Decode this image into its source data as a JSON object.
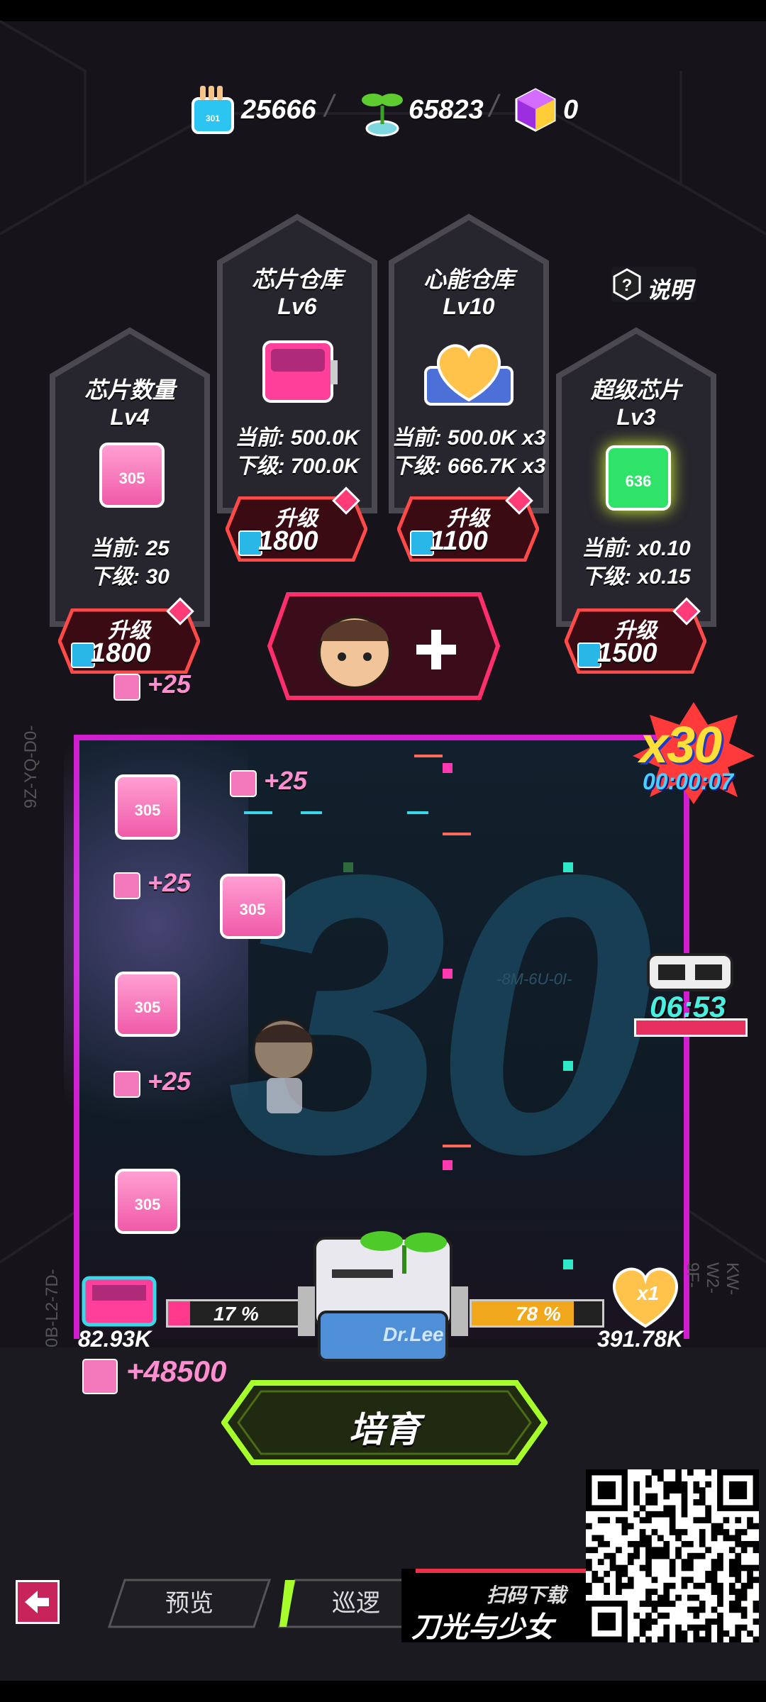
{
  "resources": [
    {
      "icon": "chip-blue-icon",
      "value": "25666"
    },
    {
      "icon": "sprout-icon",
      "value": "65823"
    },
    {
      "icon": "purple-cube-icon",
      "value": "0"
    }
  ],
  "help": {
    "label": "说明"
  },
  "towers": [
    {
      "title": "芯片数量",
      "level": "Lv4",
      "current": "当前: 25",
      "next": "下级: 30",
      "upgrade_label": "升级",
      "cost": "1800"
    },
    {
      "title": "芯片仓库",
      "level": "Lv6",
      "current": "当前: 500.0K",
      "next": "下级: 700.0K",
      "upgrade_label": "升级",
      "cost": "1800"
    },
    {
      "title": "心能仓库",
      "level": "Lv10",
      "current": "当前: 500.0K x3",
      "next": "下级: 666.7K x3",
      "upgrade_label": "升级",
      "cost": "1100"
    },
    {
      "title": "超级芯片",
      "level": "Lv3",
      "current": "当前: x0.10",
      "next": "下级: x0.15",
      "upgrade_label": "升级",
      "cost": "1500"
    }
  ],
  "chips": {
    "pink_label": "DORIS\n305",
    "blue_label": "DORIS\n301",
    "green_label": "DORIS\n636"
  },
  "stage": {
    "gain_labels": [
      "+25",
      "+25",
      "+25",
      "+25"
    ],
    "big_number": "30",
    "multiplier": "x30",
    "multiplier_timer": "00:00:07",
    "side_timer": "06:53",
    "left_code": "9Z-YQ-D0-",
    "left_code2": "0B-L2-7D-",
    "right_code": "KW-W2-9F-",
    "center_code": "-8M-6U-0I-"
  },
  "bottom": {
    "chip_amount": "82.93K",
    "chip_bar_percent_label": "17 %",
    "chip_bar_value": 0.17,
    "heart_bar_percent_label": "78 %",
    "heart_bar_value": 0.78,
    "heart_amount": "391.78K",
    "heart_multiplier": "x1",
    "gain_total": "+48500",
    "machine_label": "Dr.Lee",
    "cultivate_label": "培育"
  },
  "nav": {
    "back_icon": "back-arrow-icon",
    "tab1": "预览",
    "tab2": "巡逻"
  },
  "promo": {
    "scan": "扫码下载",
    "title": "刀光与少女"
  }
}
